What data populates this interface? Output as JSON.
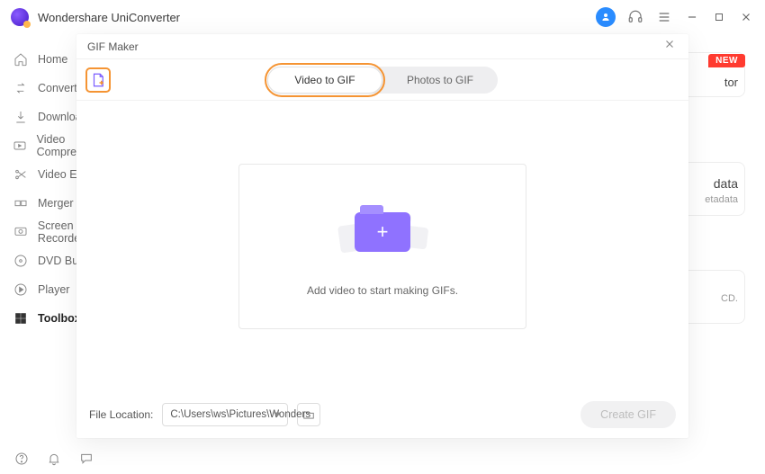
{
  "app": {
    "title": "Wondershare UniConverter"
  },
  "titlebar": {
    "icons": {
      "user": "user-icon",
      "headset": "headset-icon",
      "menu": "menu-icon",
      "minimize": "minimize-icon",
      "maximize": "maximize-icon",
      "close": "close-icon"
    }
  },
  "sidebar": {
    "items": [
      {
        "label": "Home",
        "icon": "home-icon"
      },
      {
        "label": "Converter",
        "icon": "convert-icon"
      },
      {
        "label": "Downloader",
        "icon": "download-icon"
      },
      {
        "label": "Video Compressor",
        "icon": "compress-icon"
      },
      {
        "label": "Video Editor",
        "icon": "scissors-icon"
      },
      {
        "label": "Merger",
        "icon": "merge-icon"
      },
      {
        "label": "Screen Recorder",
        "icon": "record-icon"
      },
      {
        "label": "DVD Burner",
        "icon": "dvd-icon"
      },
      {
        "label": "Player",
        "icon": "play-icon"
      },
      {
        "label": "Toolbox",
        "icon": "toolbox-icon"
      }
    ],
    "active_index": 9
  },
  "background": {
    "new_badge": "NEW",
    "top_text": "tor",
    "mid_title": "data",
    "mid_sub": "etadata",
    "low_text": "CD."
  },
  "modal": {
    "title": "GIF Maker",
    "tabs": {
      "video": "Video to GIF",
      "photos": "Photos to GIF"
    },
    "dropzone_text": "Add video to start making GIFs.",
    "file_location_label": "File Location:",
    "file_location_value": "C:\\Users\\ws\\Pictures\\Wonders",
    "create_button": "Create GIF"
  },
  "bottombar": {
    "icons": {
      "help": "help-icon",
      "bell": "bell-icon",
      "feedback": "feedback-icon"
    }
  }
}
